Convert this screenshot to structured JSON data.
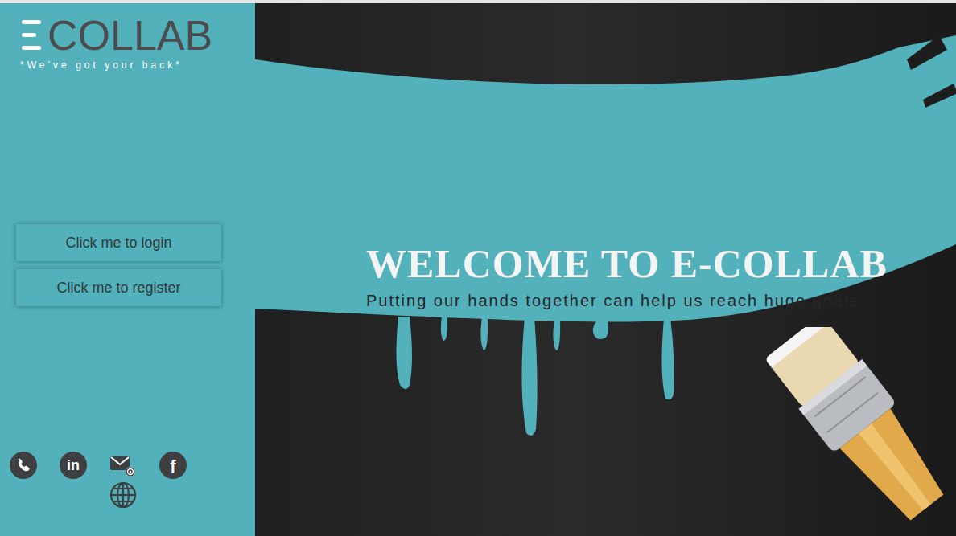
{
  "brand": {
    "logo": "COLLAB",
    "tagline": "*We’ve got your back*"
  },
  "actions": [
    "Click me to login",
    "Click me to register"
  ],
  "contacts": [
    {
      "kind": "phone"
    },
    {
      "kind": "linkedin",
      "text": "in"
    },
    {
      "kind": "email"
    },
    {
      "kind": "facebook",
      "text": "f"
    },
    {
      "kind": "web"
    }
  ],
  "hero": {
    "title": "WELCOME TO E-COLLAB",
    "subtitle": "Putting our hands together can help us reach huge goals"
  }
}
